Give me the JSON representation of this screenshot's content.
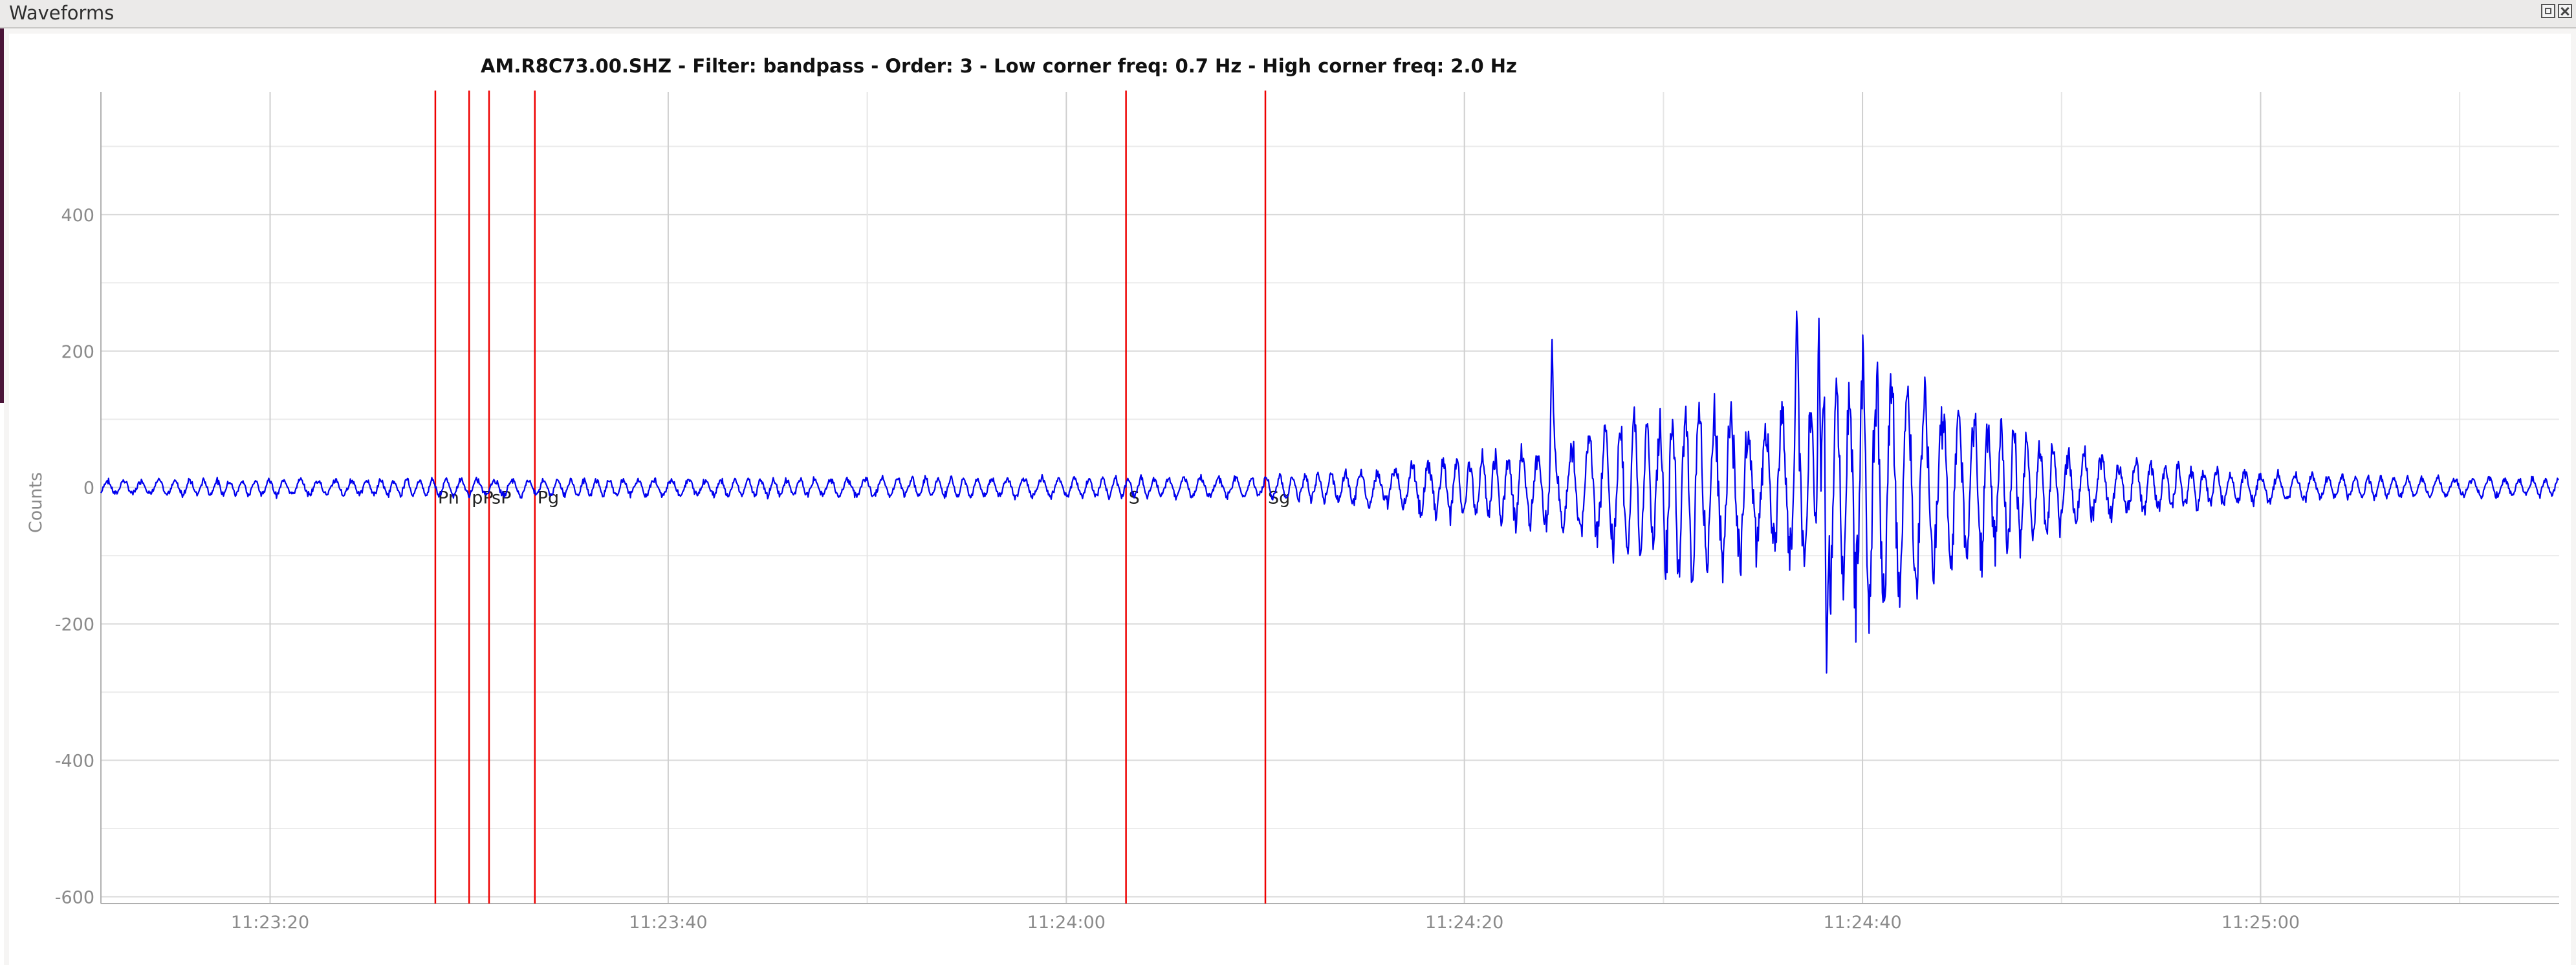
{
  "window": {
    "title": "Waveforms"
  },
  "chart_data": {
    "type": "line",
    "title": "AM.R8C73.00.SHZ - Filter: bandpass - Order: 3 - Low corner freq: 0.7 Hz - High corner freq: 2.0 Hz",
    "xlabel": "",
    "ylabel": "Counts",
    "x_ticks": [
      "11:23:20",
      "11:23:40",
      "11:24:00",
      "11:24:20",
      "11:24:40",
      "11:25:00"
    ],
    "x_range_seconds_after_11_23_00": [
      11.5,
      135.0
    ],
    "ylim": [
      -610,
      580
    ],
    "y_ticks": [
      400,
      200,
      0,
      -200,
      -400,
      -600
    ],
    "grid": true,
    "series_color": "#0000ee",
    "marker_color": "#ee0000",
    "phase_markers": [
      {
        "label": "Pn",
        "time": "11:23:28.3"
      },
      {
        "label": "pP",
        "time": "11:23:30.0"
      },
      {
        "label": "sP",
        "time": "11:23:31.0"
      },
      {
        "label": "Pg",
        "time": "11:23:33.3"
      },
      {
        "label": "S",
        "time": "11:24:03.0"
      },
      {
        "label": "Sg",
        "time": "11:24:10.0"
      }
    ],
    "envelope": {
      "description_points_time_s": [
        11.5,
        70,
        75,
        80,
        85,
        88,
        92,
        95,
        98,
        100,
        103,
        107,
        112,
        118,
        125,
        135
      ],
      "amplitude_counts": [
        15,
        20,
        35,
        60,
        80,
        130,
        180,
        120,
        180,
        280,
        180,
        120,
        60,
        35,
        20,
        18
      ]
    },
    "peaks": [
      {
        "time_s": 84.4,
        "value": 225
      },
      {
        "time_s": 97.8,
        "value": 280
      },
      {
        "time_s": 98.2,
        "value": -285
      },
      {
        "time_s": 96.7,
        "value": 275
      }
    ]
  }
}
